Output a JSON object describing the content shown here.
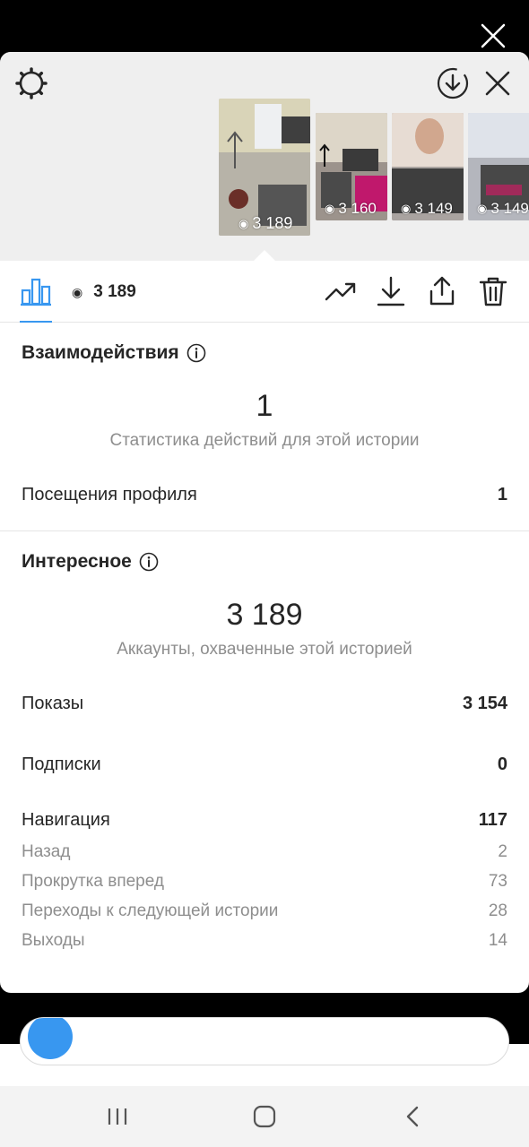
{
  "story_tray": {
    "thumbnails": [
      {
        "views": "3 189",
        "selected": true,
        "bg": "#cfd0c4"
      },
      {
        "views": "3 160",
        "selected": false,
        "bg": "#b6b0a8"
      },
      {
        "views": "3 149",
        "selected": false,
        "bg": "#b8aaa2"
      },
      {
        "views": "3 149",
        "selected": false,
        "bg": "#c4c6cc"
      }
    ],
    "eye_icon": "eye-icon"
  },
  "toolbar": {
    "views": "3 189"
  },
  "interactions": {
    "title": "Взаимодействия",
    "total": "1",
    "caption": "Статистика действий для этой истории",
    "rows": [
      {
        "label": "Посещения профиля",
        "value": "1"
      }
    ]
  },
  "discovery": {
    "title": "Интересное",
    "total": "3 189",
    "caption": "Аккаунты, охваченные этой историей",
    "impressions": {
      "label": "Показы",
      "value": "3 154"
    },
    "follows": {
      "label": "Подписки",
      "value": "0"
    },
    "navigation": {
      "label": "Навигация",
      "value": "117",
      "items": [
        {
          "label": "Назад",
          "value": "2"
        },
        {
          "label": "Прокрутка вперед",
          "value": "73"
        },
        {
          "label": "Переходы к следующей истории",
          "value": "28"
        },
        {
          "label": "Выходы",
          "value": "14"
        }
      ]
    }
  },
  "colors": {
    "accent": "#3897f0",
    "text": "#262626",
    "secondary": "#8e8e8e"
  }
}
